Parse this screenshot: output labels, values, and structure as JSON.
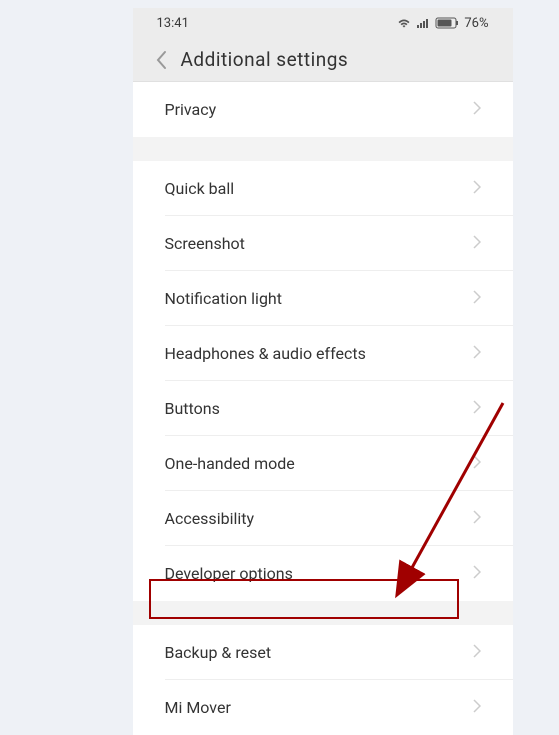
{
  "status": {
    "time": "13:41",
    "battery": "76%"
  },
  "header": {
    "title": "Additional  settings"
  },
  "groups": [
    {
      "items": [
        {
          "label": "Privacy"
        }
      ]
    },
    {
      "items": [
        {
          "label": "Quick ball"
        },
        {
          "label": "Screenshot"
        },
        {
          "label": "Notification light"
        },
        {
          "label": "Headphones & audio effects"
        },
        {
          "label": "Buttons"
        },
        {
          "label": "One-handed mode"
        },
        {
          "label": "Accessibility"
        },
        {
          "label": "Developer options"
        }
      ]
    },
    {
      "items": [
        {
          "label": "Backup & reset"
        },
        {
          "label": "Mi Mover"
        }
      ]
    }
  ],
  "annotation": {
    "highlighted_item": "Backup & reset",
    "arrow_color": "#a00000"
  }
}
